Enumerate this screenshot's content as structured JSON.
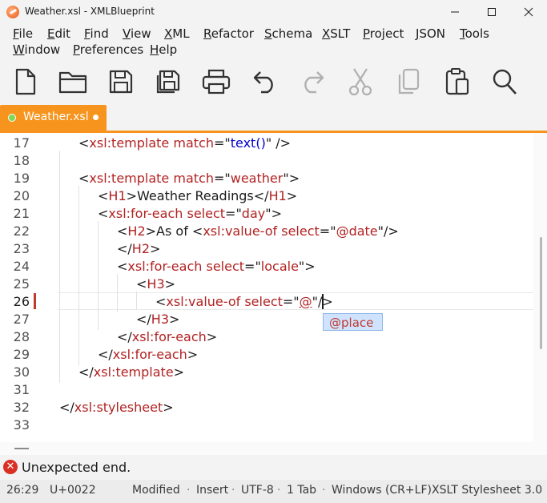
{
  "window": {
    "title": "Weather.xsl - XMLBlueprint"
  },
  "menu": {
    "row1": [
      {
        "label": "File"
      },
      {
        "label": "Edit"
      },
      {
        "label": "Find"
      },
      {
        "label": "View"
      },
      {
        "label": "XML"
      },
      {
        "label": "Refactor"
      },
      {
        "label": "Schema"
      },
      {
        "label": "XSLT"
      },
      {
        "label": "Project"
      },
      {
        "label": "JSON"
      },
      {
        "label": "Tools"
      }
    ],
    "row2": [
      {
        "label": "Window"
      },
      {
        "label": "Preferences"
      },
      {
        "label": "Help"
      }
    ]
  },
  "toolbar": {
    "icons": [
      "new-file-icon",
      "open-folder-icon",
      "save-icon",
      "save-all-icon",
      "print-icon",
      "undo-icon",
      "redo-icon",
      "cut-icon",
      "copy-icon",
      "paste-icon",
      "search-icon"
    ]
  },
  "tabs": [
    {
      "label": "Weather.xsl",
      "modified": true
    }
  ],
  "editor": {
    "lines": [
      {
        "n": "17",
        "src": "<xsl:template match=\"text()\" />"
      },
      {
        "n": "18",
        "src": ""
      },
      {
        "n": "19",
        "src": "<xsl:template match=\"weather\">"
      },
      {
        "n": "20",
        "src": "<H1>Weather Readings</H1>"
      },
      {
        "n": "21",
        "src": "<xsl:for-each select=\"day\">"
      },
      {
        "n": "22",
        "src": "<H2>As of <xsl:value-of select=\"@date\"/>"
      },
      {
        "n": "23",
        "src": "</H2>"
      },
      {
        "n": "24",
        "src": "<xsl:for-each select=\"locale\">"
      },
      {
        "n": "25",
        "src": "<H3>"
      },
      {
        "n": "26",
        "src": "<xsl:value-of select=\"@\"/>"
      },
      {
        "n": "27",
        "src": "</H3>"
      },
      {
        "n": "28",
        "src": "</xsl:for-each>"
      },
      {
        "n": "29",
        "src": "</xsl:for-each>"
      },
      {
        "n": "30",
        "src": "</xsl:template>"
      },
      {
        "n": "31",
        "src": ""
      },
      {
        "n": "32",
        "src": "</xsl:stylesheet>"
      },
      {
        "n": "33",
        "src": ""
      }
    ],
    "completion": "@place"
  },
  "message": {
    "text": "Unexpected end."
  },
  "status": {
    "position": "26:29",
    "codepoint": "U+0022",
    "state": "Modified",
    "mode": "Insert",
    "encoding": "UTF-8",
    "indent": "1 Tab",
    "line_endings": "Windows (CR+LF)",
    "doc_type": "XSLT Stylesheet 3.0"
  }
}
